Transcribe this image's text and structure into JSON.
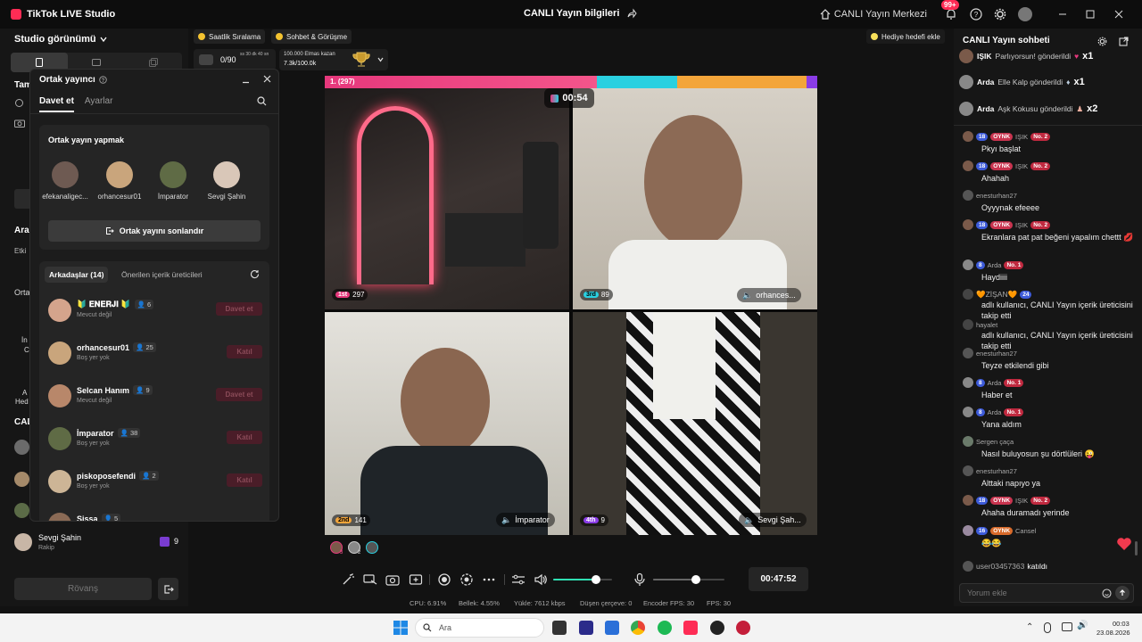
{
  "app": {
    "title": "TikTok LIVE Studio",
    "center_title": "CANLI Yayın bilgileri",
    "live_center": "CANLI Yayın Merkezi",
    "notif_badge": "99+"
  },
  "left": {
    "studio_view": "Studio görünümü",
    "tam": "Tam",
    "ara": "Ara",
    "etk": "Etki",
    "orta": "Orta",
    "in": "İn",
    "c": "C",
    "a": "A",
    "hed": "Hed",
    "cal": "CAL",
    "opponent": {
      "name": "Sevgi Şahin",
      "role": "Rakip",
      "score": "9"
    },
    "rematch": "Rövanş"
  },
  "dialog": {
    "title": "Ortak yayıncı",
    "tabs": [
      "Davet et",
      "Ayarlar"
    ],
    "cohost_title": "Ortak yayın yapmak",
    "cohosts": [
      "efekanaligec...",
      "orhancesur01",
      "İmparator",
      "Sevgi Şahin"
    ],
    "end_button": "Ortak yayını sonlandır",
    "friends_tab": "Arkadaşlar (14)",
    "suggested_tab": "Önerilen içerik üreticileri",
    "friends": [
      {
        "name": "🔰 𝐄𝐍𝐄𝐑𝐉𝐈 🔰",
        "count": "6",
        "status": "Mevcut değil",
        "action": "Davet et"
      },
      {
        "name": "orhancesur01",
        "count": "25",
        "status": "Boş yer yok",
        "action": "Katıl"
      },
      {
        "name": "Selcan Hanım",
        "count": "9",
        "status": "Mevcut değil",
        "action": "Davet et"
      },
      {
        "name": "İmparator",
        "count": "38",
        "status": "Boş yer yok",
        "action": "Katıl"
      },
      {
        "name": "piskoposefendi",
        "count": "2",
        "status": "Boş yer yok",
        "action": "Katıl"
      },
      {
        "name": "Sissa",
        "count": "5",
        "status": "",
        "action": ""
      }
    ]
  },
  "topbar": {
    "ranking": "Saatlik Sıralama",
    "chat_meet": "Sohbet & Görüşme",
    "gift_goal": "Hediye hedefi ekle",
    "progress": "0/90",
    "progress_sub": "ss 30 dk 40 sn",
    "diamond_label": "100.000 Elmas kazan",
    "diamond_value": "7.3k/100.0k",
    "diamond_fraction": 0.073
  },
  "battle": {
    "lead_label": "1. (297)",
    "timer": "00:54",
    "tiles": [
      {
        "rank": "1st",
        "score": "297",
        "name": ""
      },
      {
        "rank": "3rd",
        "score": "89",
        "name": "orhances..."
      },
      {
        "rank": "2nd",
        "score": "141",
        "name": "İmparator"
      },
      {
        "rank": "4th",
        "score": "9",
        "name": "Sevgi Şah..."
      }
    ],
    "team_counts": [
      "3",
      "2",
      ""
    ]
  },
  "controls": {
    "elapsed": "00:47:52",
    "volume_level": 0.72,
    "mic_level": 0.6
  },
  "stats": {
    "cpu": "CPU:  6.91%",
    "memory": "Bellek:  4.55%",
    "upload": "Yükle:  7612 kbps",
    "dropped": "Düşen çerçeve:  0",
    "encoder_fps": "Encoder FPS:  30",
    "fps": "FPS:  30"
  },
  "chat": {
    "title": "CANLI Yayın sohbeti",
    "gifts": [
      {
        "user": "IŞIK",
        "text": "Parlıyorsun! gönderildi",
        "mult": "x1"
      },
      {
        "user": "Arda",
        "text": "Elle Kalp gönderildi",
        "mult": "x1"
      },
      {
        "user": "Arda",
        "text": "Aşk Kokusu gönderildi",
        "mult": "x2"
      }
    ],
    "messages": [
      {
        "lvl": "18",
        "tag": "OYNK",
        "user": "IŞIK",
        "no": "No. 2",
        "text": "Pkyı başlat"
      },
      {
        "lvl": "18",
        "tag": "OYNK",
        "user": "IŞIK",
        "no": "No. 2",
        "text": "Ahahah"
      },
      {
        "user": "enesturhan27",
        "text": "Oyyynak efeeee"
      },
      {
        "lvl": "18",
        "tag": "OYNK",
        "user": "IŞIK",
        "no": "No. 2",
        "text": "Ekranlara pat pat beğeni yapalım chettt 💋"
      },
      {
        "lvl": "8",
        "user": "Arda",
        "no": "No. 1",
        "text": "Haydiiii"
      },
      {
        "user": "🧡ZİŞAN🧡",
        "lvl": "24",
        "text": "adlı kullanıcı, CANLI Yayın içerik üreticisini takip etti"
      },
      {
        "user": "hayalet",
        "text": "adlı kullanıcı, CANLI Yayın içerik üreticisini takip etti"
      },
      {
        "user": "enesturhan27",
        "text": "Teyze etkilendi gibi"
      },
      {
        "lvl": "8",
        "user": "Arda",
        "no": "No. 1",
        "text": "Haber et"
      },
      {
        "lvl": "8",
        "user": "Arda",
        "no": "No. 1",
        "text": "Yana aldım"
      },
      {
        "user": "Sergen çaça",
        "text": "Nasıl buluyosun şu dörtlüleri 😜"
      },
      {
        "user": "enesturhan27",
        "text": "Alttaki napıyo ya"
      },
      {
        "lvl": "18",
        "tag": "OYNK",
        "user": "IŞIK",
        "no": "No. 2",
        "text": "Ahaha duramadı yerinde"
      },
      {
        "lvl": "16",
        "tag": "OYNK",
        "user": "Cansel",
        "text": "😂😂"
      },
      {
        "user": "user03457363",
        "text": "katıldı"
      }
    ],
    "input_placeholder": "Yorum ekle"
  },
  "taskbar": {
    "search": "Ara",
    "time": "00:03",
    "date": "23.08.2026"
  }
}
